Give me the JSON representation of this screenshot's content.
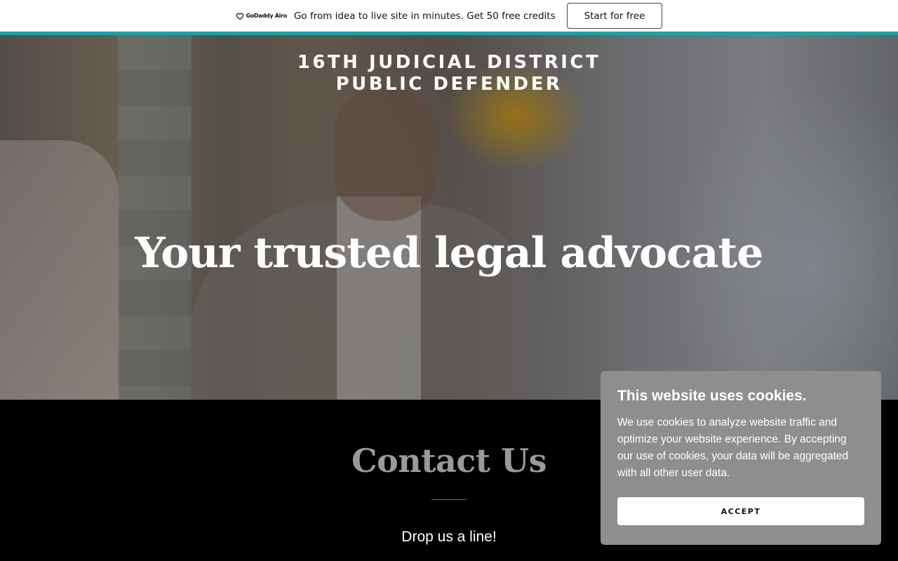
{
  "promo": {
    "logo_text": "GoDaddy Airo",
    "message": "Go from idea to live site in minutes. Get 50 free credits",
    "cta_label": "Start for free"
  },
  "hero": {
    "site_name_line1": "16TH JUDICIAL DISTRICT",
    "site_name_line2": "PUBLIC DEFENDER",
    "heading": "Your trusted legal advocate"
  },
  "contact": {
    "title": "Contact Us",
    "subtitle": "Drop us a line!"
  },
  "cookie_banner": {
    "title": "This website uses cookies.",
    "body": "We use cookies to analyze website traffic and optimize your website experience. By accepting our use of cookies, your data will be aggregated with all other user data.",
    "accept_label": "ACCEPT"
  },
  "colors": {
    "accent_bar": "#1ba3a3",
    "cookie_bg": "#8e8e8e",
    "contact_bg": "#000000"
  }
}
